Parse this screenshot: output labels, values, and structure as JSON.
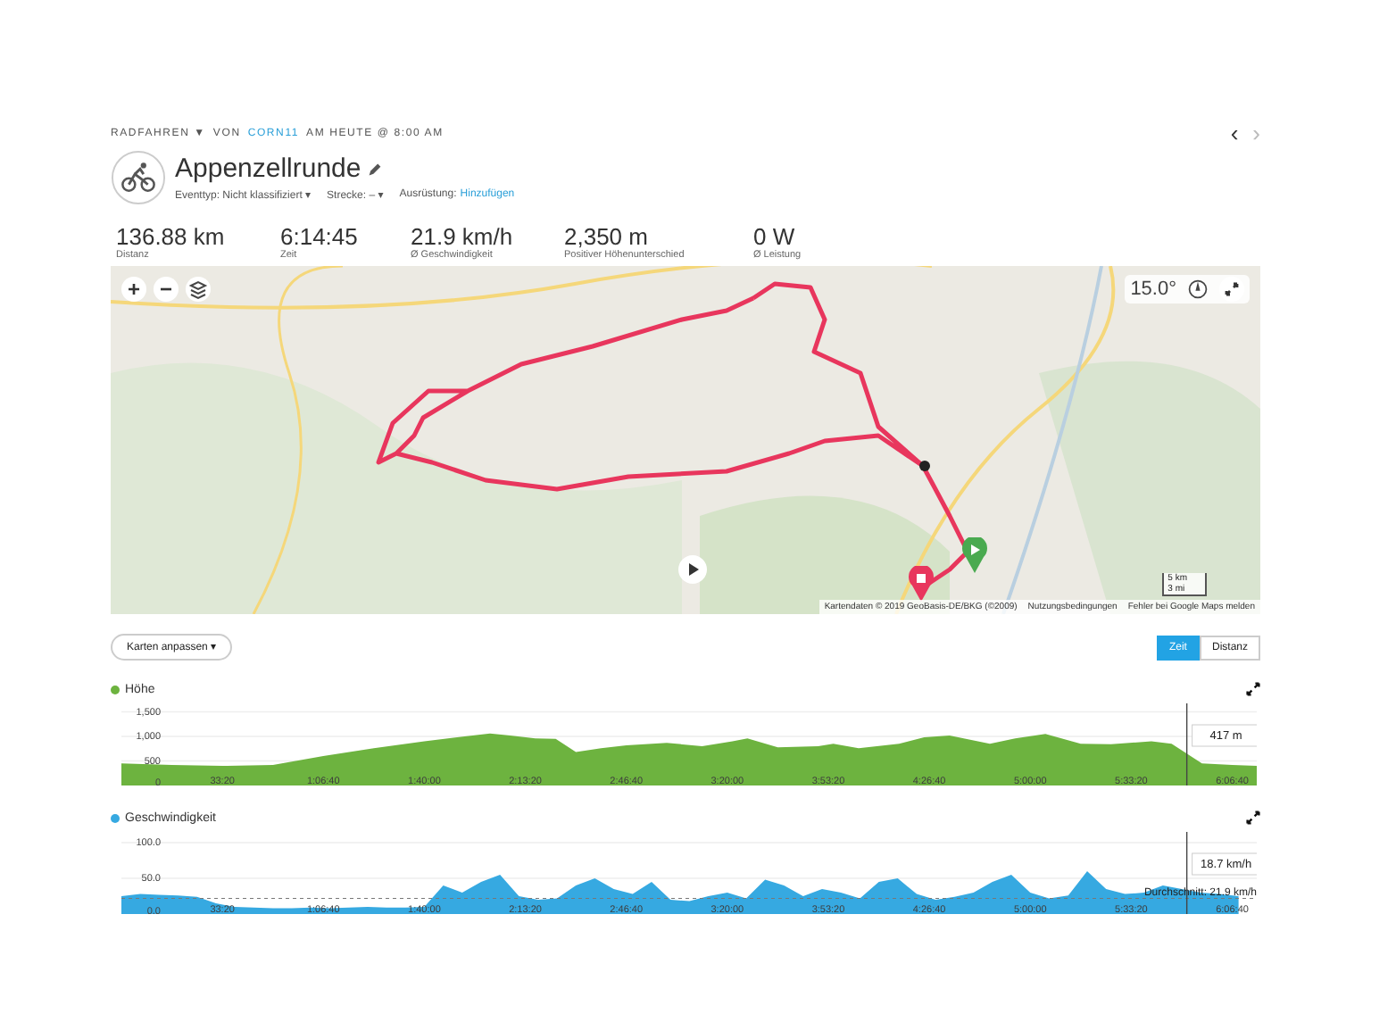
{
  "header": {
    "activity_type": "RADFAHREN ▼",
    "by": "VON",
    "user": "CORN11",
    "when": "AM HEUTE @ 8:00 AM",
    "prev": "‹",
    "next": "›"
  },
  "title": "Appenzellrunde",
  "meta": [
    {
      "label": "Eventtyp: Nicht klassifiziert ▾",
      "kind": "dropdown"
    },
    {
      "label": "Strecke: – ▾",
      "kind": "dropdown"
    },
    {
      "label": "Ausrüstung:",
      "kind": "link",
      "link": "Hinzufügen"
    }
  ],
  "stats": [
    {
      "value": "136.88 km",
      "label": "Distanz"
    },
    {
      "value": "6:14:45",
      "label": "Zeit"
    },
    {
      "value": "21.9 km/h",
      "label": "Ø Geschwindigkeit"
    },
    {
      "value": "2,350 m",
      "label": "Positiver Höhenunterschied"
    },
    {
      "value": "0 W",
      "label": "Ø Leistung"
    }
  ],
  "map": {
    "zoom_in": "+",
    "zoom_out": "−",
    "heading": "15.0°",
    "scale_km": "5 km",
    "scale_mi": "3 mi",
    "attribution": "Kartendaten © 2019 GeoBasis-DE/BKG (©2009)",
    "terms": "Nutzungsbedingungen",
    "report": "Fehler bei Google Maps melden"
  },
  "fit_button": "Karten anpassen ▾",
  "axis_toggle": [
    {
      "label": "Zeit",
      "selected": true
    },
    {
      "label": "Distanz",
      "selected": false
    }
  ],
  "chart_panels": [
    {
      "chart_data": {
        "type": "area",
        "grid": true,
        "xlim": [
          0,
          22485
        ],
        "ylim": [
          0,
          1600
        ],
        "yticks": [
          {
            "value": 0,
            "label": "0"
          },
          {
            "value": 500,
            "label": "500"
          },
          {
            "value": 1000,
            "label": "1,000"
          },
          {
            "value": 1500,
            "label": "1,500"
          }
        ],
        "xticks": [
          {
            "value": 2000,
            "label": "33:20"
          },
          {
            "value": 4000,
            "label": "1:06:40"
          },
          {
            "value": 6000,
            "label": "1:40:00"
          },
          {
            "value": 8000,
            "label": "2:13:20"
          },
          {
            "value": 10000,
            "label": "2:46:40"
          },
          {
            "value": 12000,
            "label": "3:20:00"
          },
          {
            "value": 14000,
            "label": "3:53:20"
          },
          {
            "value": 16000,
            "label": "4:26:40"
          },
          {
            "value": 18000,
            "label": "5:00:00"
          },
          {
            "value": 20000,
            "label": "5:33:20"
          },
          {
            "value": 22000,
            "label": "6:06:40"
          }
        ],
        "x": [
          0,
          1000,
          2000,
          3000,
          4000,
          5000,
          6000,
          6800,
          7300,
          7700,
          8200,
          8600,
          9000,
          9500,
          10000,
          10800,
          11500,
          12100,
          12400,
          13000,
          13800,
          14100,
          14600,
          15400,
          15900,
          16400,
          17200,
          17700,
          18300,
          19000,
          19600,
          20400,
          20800,
          21400,
          22000,
          22485
        ],
        "series": [
          {
            "name": "Höhe",
            "color": "#6db33f",
            "values": [
              450,
              420,
              400,
              420,
              600,
              760,
              900,
              1000,
              1060,
              1020,
              960,
              950,
              680,
              760,
              820,
              870,
              800,
              900,
              960,
              780,
              800,
              850,
              760,
              850,
              980,
              1020,
              850,
              960,
              1050,
              850,
              840,
              900,
              850,
              450,
              420,
              400
            ]
          }
        ],
        "ref_lines": [
          {
            "axis": "x",
            "value": 21100,
            "label": "417 m"
          }
        ]
      }
    },
    {
      "chart_data": {
        "type": "area",
        "grid": true,
        "xlim": [
          0,
          22485
        ],
        "ylim": [
          0,
          110
        ],
        "yticks": [
          {
            "value": 0,
            "label": "0.0"
          },
          {
            "value": 50,
            "label": "50.0"
          },
          {
            "value": 100,
            "label": "100.0"
          }
        ],
        "xticks": [
          {
            "value": 2000,
            "label": "33:20"
          },
          {
            "value": 4000,
            "label": "1:06:40"
          },
          {
            "value": 6000,
            "label": "1:40:00"
          },
          {
            "value": 8000,
            "label": "2:13:20"
          },
          {
            "value": 10000,
            "label": "2:46:40"
          },
          {
            "value": 12000,
            "label": "3:20:00"
          },
          {
            "value": 14000,
            "label": "3:53:20"
          },
          {
            "value": 16000,
            "label": "4:26:40"
          },
          {
            "value": 18000,
            "label": "5:00:00"
          },
          {
            "value": 20000,
            "label": "5:33:20"
          },
          {
            "value": 22000,
            "label": "6:06:40"
          }
        ],
        "x": [
          0,
          375,
          750,
          1125,
          1500,
          1875,
          2250,
          2625,
          3000,
          3375,
          3750,
          4125,
          4500,
          4875,
          5250,
          5625,
          6000,
          6375,
          6750,
          7125,
          7500,
          7875,
          8250,
          8625,
          9000,
          9375,
          9750,
          10125,
          10500,
          10875,
          11250,
          11625,
          12000,
          12375,
          12750,
          13125,
          13500,
          13875,
          14250,
          14625,
          15000,
          15375,
          15750,
          16125,
          16500,
          16875,
          17250,
          17625,
          18000,
          18375,
          18750,
          19125,
          19500,
          19875,
          20250,
          20625,
          21000,
          21375,
          21750,
          22125
        ],
        "series": [
          {
            "name": "Geschwindigkeit",
            "color": "#36a9e1",
            "values": [
              25,
              28,
              27,
              26,
              24,
              15,
              10,
              9,
              8,
              8,
              9,
              8,
              9,
              10,
              9,
              9,
              10,
              40,
              30,
              45,
              55,
              25,
              20,
              22,
              40,
              50,
              35,
              28,
              45,
              20,
              18,
              25,
              30,
              22,
              48,
              40,
              25,
              35,
              30,
              22,
              45,
              50,
              28,
              20,
              24,
              30,
              45,
              55,
              30,
              22,
              26,
              60,
              35,
              28,
              30,
              40,
              35,
              30,
              28,
              25
            ]
          }
        ],
        "ref_lines": [
          {
            "axis": "y",
            "value": 21.9,
            "label": "Durchschnitt: 21.9 km/h"
          },
          {
            "axis": "x",
            "value": 21100,
            "label": "18.7 km/h"
          }
        ]
      }
    }
  ]
}
